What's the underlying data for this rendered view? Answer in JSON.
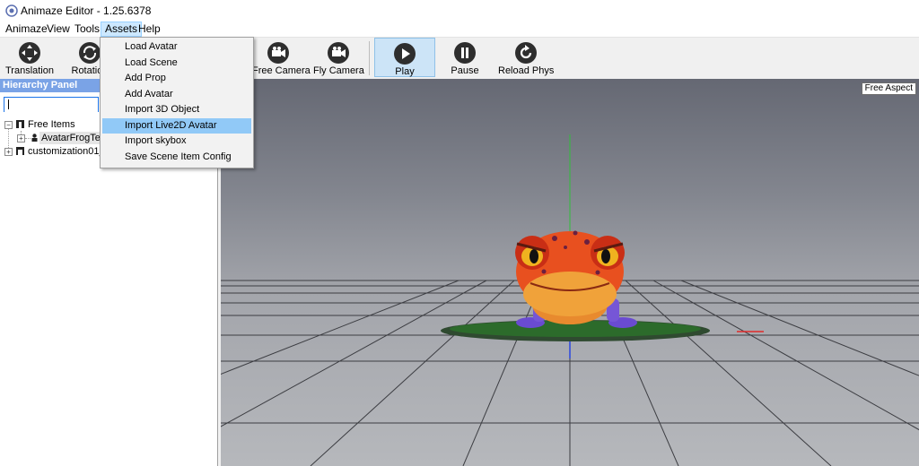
{
  "window": {
    "title": "Animaze Editor - 1.25.6378",
    "icon": "animaze-logo-icon"
  },
  "menubar": {
    "items": [
      "Animaze",
      "View",
      "Tools",
      "Assets",
      "Help"
    ],
    "active": "Assets"
  },
  "toolbar": {
    "translation_label": "Translation",
    "rotation_label": "Rotation",
    "free_camera_label": "Free Camera",
    "fly_camera_label": "Fly Camera",
    "play_label": "Play",
    "pause_label": "Pause",
    "reload_label": "Reload Phys"
  },
  "assets_menu": {
    "items": [
      "Load Avatar",
      "Load Scene",
      "Add Prop",
      "Add Avatar",
      "Import 3D Object",
      "Import Live2D Avatar",
      "Import skybox",
      "Save Scene Item Config"
    ],
    "highlighted": "Import Live2D Avatar"
  },
  "hierarchy": {
    "title": "Hierarchy Panel",
    "search_value": "",
    "tree": {
      "free_items": "Free Items",
      "avatar": "AvatarFrogTest",
      "customization": "customization01_sc"
    }
  },
  "viewport": {
    "aspect_label": "Free Aspect"
  },
  "colors": {
    "selected_bg": "#cce4f7",
    "menu_highlight": "#91c9f7",
    "panel_header": "#7aa3e6"
  }
}
